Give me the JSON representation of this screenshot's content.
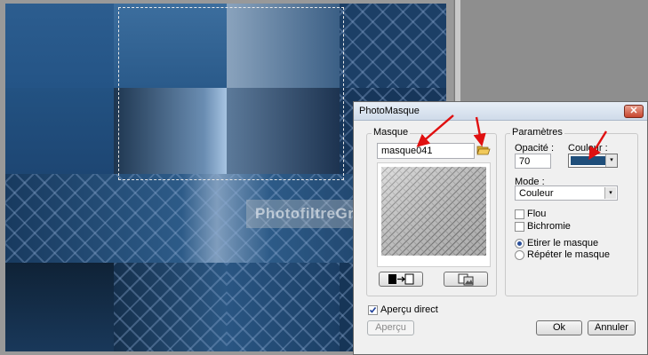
{
  "watermark": "PhotofiltreGraph",
  "dialog": {
    "title": "PhotoMasque",
    "close_glyph": "✕",
    "masque": {
      "label": "Masque",
      "file_value": "masque041",
      "folder_icon": "folder-open-icon",
      "invert_icon": "invert-mask-icon",
      "image_icon": "image-swap-icon"
    },
    "parametres": {
      "label": "Paramètres",
      "opacity_label": "Opacité :",
      "opacity_value": "70",
      "color_label": "Couleur :",
      "color_value": "#1f4e7a",
      "mode_label": "Mode :",
      "mode_value": "Couleur",
      "flou_label": "Flou",
      "bichromie_label": "Bichromie",
      "etirer_label": "Etirer le masque",
      "repeter_label": "Répéter le masque"
    },
    "apercu_direct_label": "Aperçu direct",
    "apercu_button": "Aperçu",
    "ok_button": "Ok",
    "annuler_button": "Annuler"
  },
  "colors": {
    "arrow": "#e01010"
  }
}
